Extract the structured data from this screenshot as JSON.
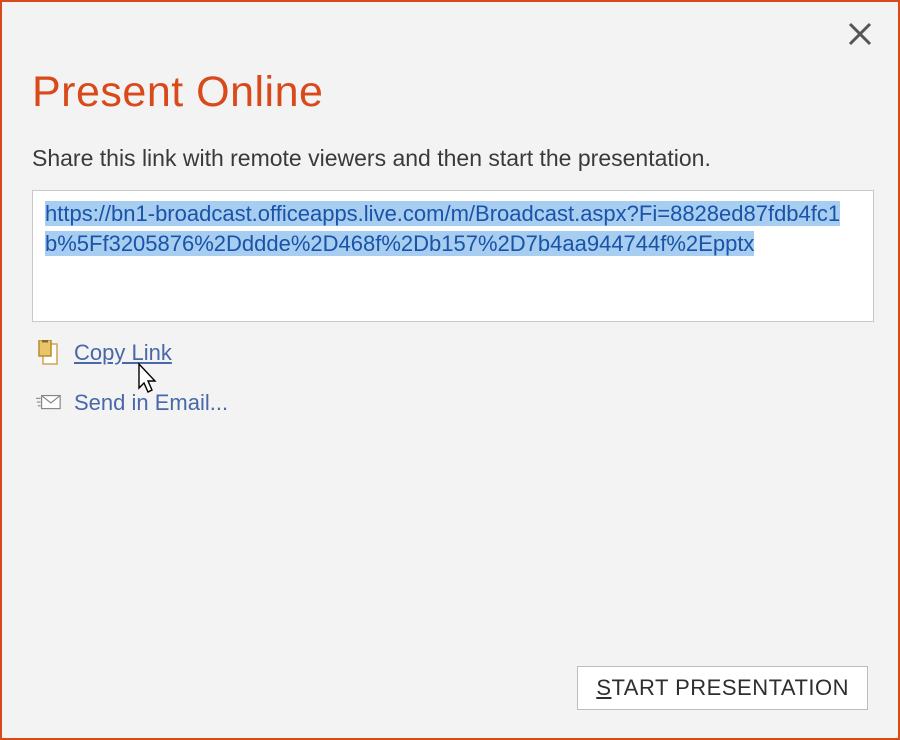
{
  "dialog": {
    "title": "Present Online",
    "instruction": "Share this link with remote viewers and then start the presentation.",
    "share_link": "https://bn1-broadcast.officeapps.live.com/m/Broadcast.aspx?Fi=8828ed87fdb4fc1b%5Ff3205876%2Dddde%2D468f%2Db157%2D7b4aa944744f%2Epptx",
    "actions": {
      "copy_link_label": "Copy Link",
      "send_email_label": "Send in Email..."
    },
    "start_button": {
      "prefix": "S",
      "rest": "TART PRESENTATION"
    }
  },
  "colors": {
    "accent": "#d94a1a",
    "link": "#4868a8",
    "hyperlink": "#1a53a8",
    "selection": "#a7cef0"
  }
}
